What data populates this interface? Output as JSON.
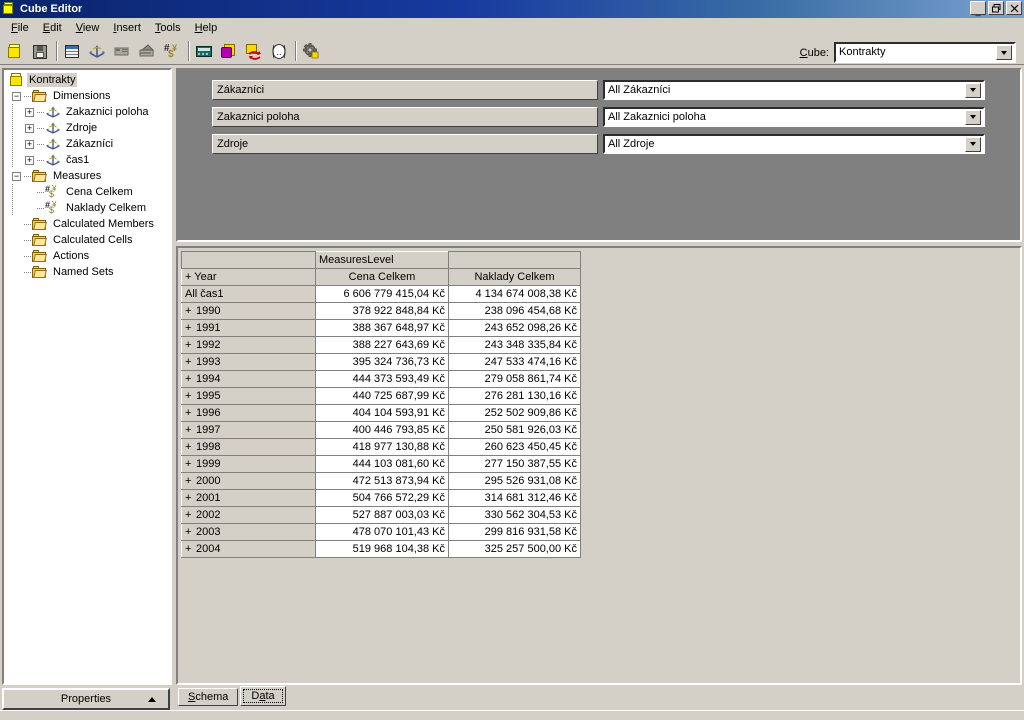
{
  "window": {
    "title": "Cube Editor",
    "icon": "cube-icon",
    "buttons": {
      "minimize": "_",
      "restore": "❐",
      "close": "✕"
    }
  },
  "menu": {
    "items": [
      {
        "label": "File",
        "accel": "F"
      },
      {
        "label": "Edit",
        "accel": "E"
      },
      {
        "label": "View",
        "accel": "V"
      },
      {
        "label": "Insert",
        "accel": "I"
      },
      {
        "label": "Tools",
        "accel": "T"
      },
      {
        "label": "Help",
        "accel": "H"
      }
    ]
  },
  "toolbar": {
    "buttons": [
      {
        "name": "cube-icon",
        "tip": "Cube"
      },
      {
        "name": "save-icon",
        "tip": "Save"
      },
      {
        "name": "grid-icon",
        "tip": "Properties"
      },
      {
        "name": "dimension-axes-icon",
        "tip": "New Dimension"
      },
      {
        "name": "rename-icon",
        "tip": "Rename"
      },
      {
        "name": "drill-icon",
        "tip": "Drillthrough"
      },
      {
        "name": "measure-currency-icon",
        "tip": "New Measure"
      },
      {
        "name": "calculator-icon",
        "tip": "Calculate"
      },
      {
        "name": "calculated-member-icon",
        "tip": "New Calculated Member"
      },
      {
        "name": "calculated-cell-icon",
        "tip": "New Calculated Cell"
      },
      {
        "name": "named-set-icon",
        "tip": "New Named Set"
      },
      {
        "name": "action-gear-icon",
        "tip": "New Action"
      }
    ]
  },
  "cube_selector": {
    "label": "Cube:",
    "accel": "C",
    "value": "Kontrakty"
  },
  "tree": {
    "root": {
      "label": "Kontrakty",
      "icon": "cube-icon",
      "selected": true
    },
    "nodes": [
      {
        "label": "Dimensions",
        "icon": "folder-icon",
        "depth": 1,
        "expander": "-"
      },
      {
        "label": "Zakaznici poloha",
        "icon": "dimension-icon",
        "depth": 2,
        "expander": "+"
      },
      {
        "label": "Zdroje",
        "icon": "dimension-icon",
        "depth": 2,
        "expander": "+"
      },
      {
        "label": "Zákazníci",
        "icon": "dimension-icon",
        "depth": 2,
        "expander": "+"
      },
      {
        "label": "čas1",
        "icon": "dimension-icon",
        "depth": 2,
        "expander": "+"
      },
      {
        "label": "Measures",
        "icon": "folder-icon",
        "depth": 1,
        "expander": "-"
      },
      {
        "label": "Cena Celkem",
        "icon": "measure-icon",
        "depth": 2,
        "expander": ""
      },
      {
        "label": "Naklady Celkem",
        "icon": "measure-icon",
        "depth": 2,
        "expander": ""
      },
      {
        "label": "Calculated Members",
        "icon": "folder-icon",
        "depth": 1,
        "expander": ""
      },
      {
        "label": "Calculated Cells",
        "icon": "folder-icon",
        "depth": 1,
        "expander": ""
      },
      {
        "label": "Actions",
        "icon": "folder-icon",
        "depth": 1,
        "expander": ""
      },
      {
        "label": "Named Sets",
        "icon": "folder-icon",
        "depth": 1,
        "expander": ""
      }
    ]
  },
  "properties_bar": {
    "label": "Properties",
    "arrow": "up-arrow-icon"
  },
  "slicers": [
    {
      "name": "Zákazníci",
      "value": "All Zákazníci"
    },
    {
      "name": "Zakaznici poloha",
      "value": "All Zakaznici poloha"
    },
    {
      "name": "Zdroje",
      "value": "All Zdroje"
    }
  ],
  "grid": {
    "measures_level_label": "MeasuresLevel",
    "row_axis_header": "+ Year",
    "measure_columns": [
      "Cena Celkem",
      "Naklady Celkem"
    ],
    "rows": [
      {
        "label": "All čas1",
        "expandable": false,
        "values": [
          "6 606 779 415,04 Kč",
          "4 134 674 008,38 Kč"
        ]
      },
      {
        "label": "1990",
        "expandable": true,
        "values": [
          "378 922 848,84 Kč",
          "238 096 454,68 Kč"
        ]
      },
      {
        "label": "1991",
        "expandable": true,
        "values": [
          "388 367 648,97 Kč",
          "243 652 098,26 Kč"
        ]
      },
      {
        "label": "1992",
        "expandable": true,
        "values": [
          "388 227 643,69 Kč",
          "243 348 335,84 Kč"
        ]
      },
      {
        "label": "1993",
        "expandable": true,
        "values": [
          "395 324 736,73 Kč",
          "247 533 474,16 Kč"
        ]
      },
      {
        "label": "1994",
        "expandable": true,
        "values": [
          "444 373 593,49 Kč",
          "279 058 861,74 Kč"
        ]
      },
      {
        "label": "1995",
        "expandable": true,
        "values": [
          "440 725 687,99 Kč",
          "276 281 130,16 Kč"
        ]
      },
      {
        "label": "1996",
        "expandable": true,
        "values": [
          "404 104 593,91 Kč",
          "252 502 909,86 Kč"
        ]
      },
      {
        "label": "1997",
        "expandable": true,
        "values": [
          "400 446 793,85 Kč",
          "250 581 926,03 Kč"
        ]
      },
      {
        "label": "1998",
        "expandable": true,
        "values": [
          "418 977 130,88 Kč",
          "260 623 450,45 Kč"
        ]
      },
      {
        "label": "1999",
        "expandable": true,
        "values": [
          "444 103 081,60 Kč",
          "277 150 387,55 Kč"
        ]
      },
      {
        "label": "2000",
        "expandable": true,
        "values": [
          "472 513 873,94 Kč",
          "295 526 931,08 Kč"
        ]
      },
      {
        "label": "2001",
        "expandable": true,
        "values": [
          "504 766 572,29 Kč",
          "314 681 312,46 Kč"
        ]
      },
      {
        "label": "2002",
        "expandable": true,
        "values": [
          "527 887 003,03 Kč",
          "330 562 304,53 Kč"
        ]
      },
      {
        "label": "2003",
        "expandable": true,
        "values": [
          "478 070 101,43 Kč",
          "299 816 931,58 Kč"
        ]
      },
      {
        "label": "2004",
        "expandable": true,
        "values": [
          "519 968 104,38 Kč",
          "325 257 500,00 Kč"
        ]
      }
    ]
  },
  "tabs": [
    {
      "label": "Schema",
      "accel": "S",
      "active": false
    },
    {
      "label": "Data",
      "accel": "a",
      "active": true
    }
  ],
  "colors": {
    "titlebar_start": "#0a246a",
    "titlebar_end": "#7ba2d0",
    "window_face": "#d4d0c8",
    "slicer_panel": "#808080",
    "grid_cell_bg": "#ffffff",
    "selection": "#d4d0c8"
  }
}
